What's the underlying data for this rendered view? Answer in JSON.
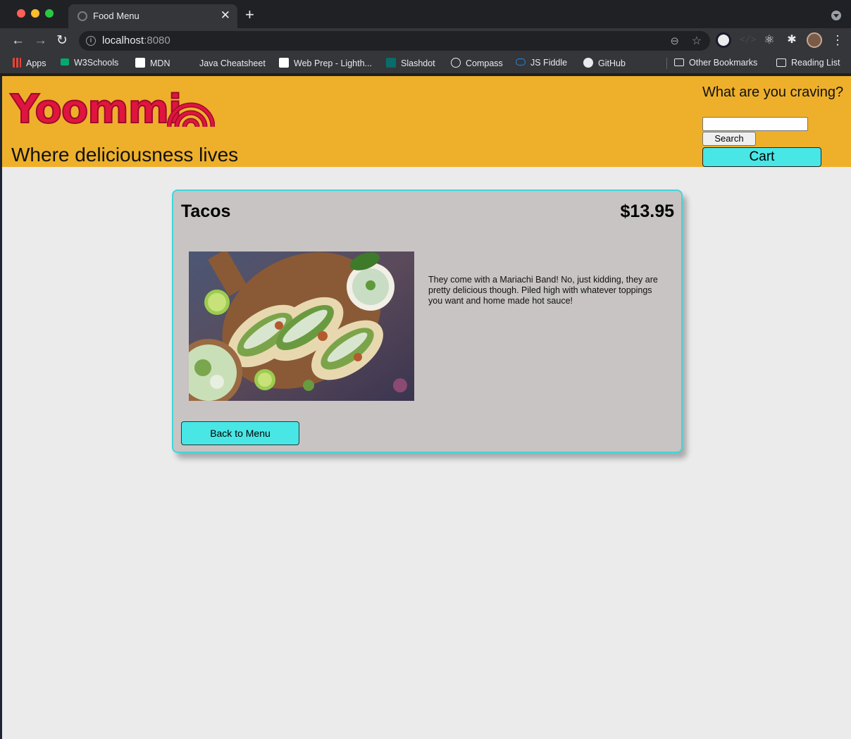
{
  "browser": {
    "tab_title": "Food Menu",
    "url_host": "localhost",
    "url_port": ":8080",
    "bookmarks": [
      "Apps",
      "W3Schools",
      "MDN",
      "Java Cheatsheet",
      "Web Prep - Lighth...",
      "Slashdot",
      "Compass",
      "JS Fiddle",
      "GitHub"
    ],
    "other_bookmarks": "Other Bookmarks",
    "reading_list": "Reading List"
  },
  "header": {
    "logo_text": "Yoommi",
    "tagline": "Where deliciousness lives",
    "search_label": "What are you craving?",
    "search_value": "",
    "search_button": "Search",
    "cart_button": "Cart",
    "brand_color": "#e0153f",
    "header_color": "#eeb02b",
    "accent_color": "#49e6e6"
  },
  "item": {
    "name": "Tacos",
    "price": "$13.95",
    "description": "They come with a Mariachi Band! No, just kidding, they are pretty delicious though. Piled high with whatever toppings you want and home made hot sauce!",
    "back_button": "Back to Menu"
  }
}
